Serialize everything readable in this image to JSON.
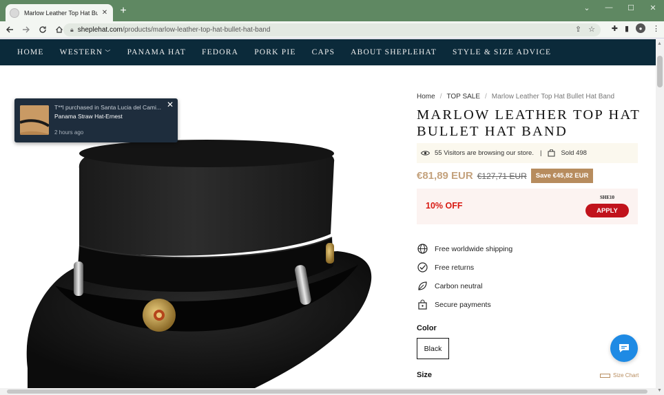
{
  "browser": {
    "tab_title": "Marlow Leather Top Hat Bullet H",
    "url_host": "sheplehat.com",
    "url_path": "/products/marlow-leather-top-hat-bullet-hat-band"
  },
  "nav": {
    "items": [
      "HOME",
      "WESTERN",
      "PANAMA HAT",
      "FEDORA",
      "PORK PIE",
      "CAPS",
      "ABOUT SHEPLEHAT",
      "STYLE & SIZE ADVICE"
    ]
  },
  "popup": {
    "line1": "T**l purchased in Santa Lucia del Cami...",
    "product": "Panama Straw Hat-Ernest",
    "time": "2 hours ago"
  },
  "breadcrumb": {
    "home": "Home",
    "sep": "/",
    "category": "TOP SALE",
    "current": "Marlow Leather Top Hat Bullet Hat Band"
  },
  "product": {
    "title": "MARLOW LEATHER TOP HAT BULLET HAT BAND",
    "visitors": "55 Visitors are browsing our store.",
    "visitors_sep": "|",
    "sold": "Sold 498",
    "price": "€81,89 EUR",
    "compare_price": "€127,71 EUR",
    "save": "Save €45,82 EUR"
  },
  "coupon": {
    "discount": "10% OFF",
    "code": "SHE10",
    "apply": "APPLY"
  },
  "features": [
    "Free worldwide shipping",
    "Free returns",
    "Carbon neutral",
    "Secure payments"
  ],
  "options": {
    "color_label": "Color",
    "color_value": "Black",
    "size_label": "Size",
    "size_chart": "Size Chart"
  },
  "colors": {
    "nav_bg": "#0b2a3a",
    "price": "#c4a27d",
    "save_bg": "#b78c5e",
    "discount": "#d81a12",
    "chat": "#1e8ae4"
  }
}
